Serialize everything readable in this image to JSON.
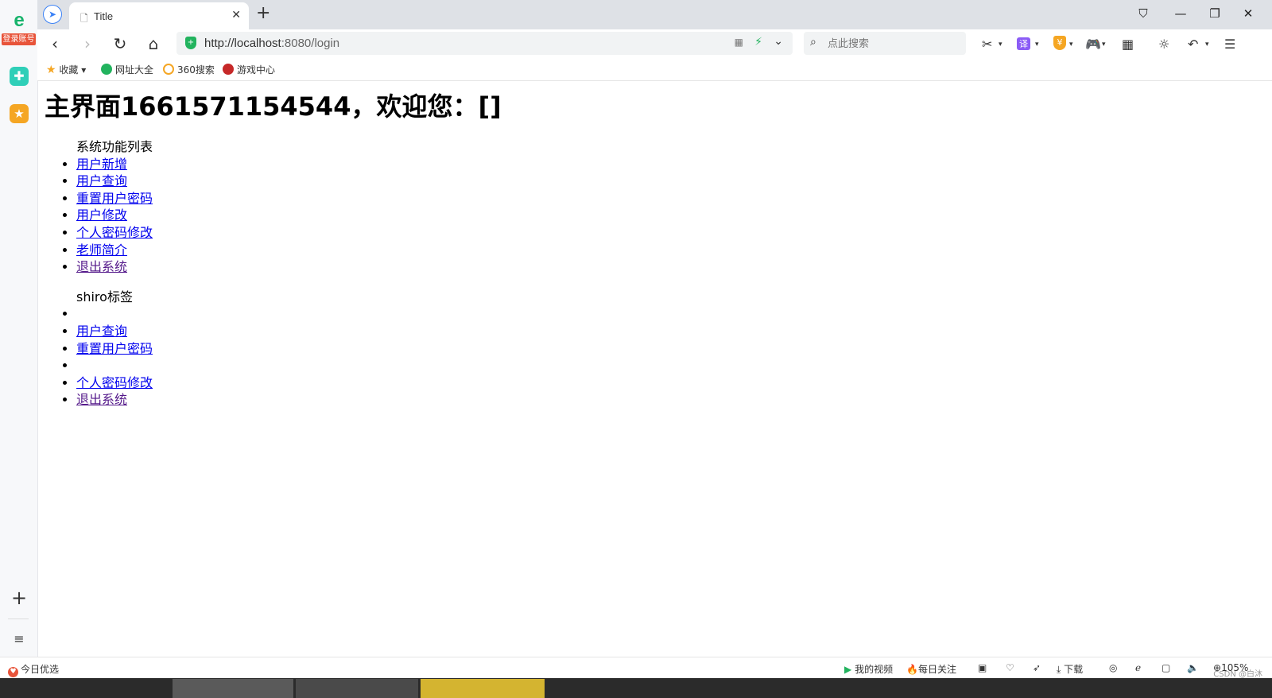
{
  "rail": {
    "logo_glyph": "e",
    "login_badge": "登录账号",
    "plus_glyph": "+",
    "list_glyph": "≡"
  },
  "tabs": [
    {
      "title": "Title",
      "close": "✕"
    }
  ],
  "new_tab": "+",
  "window_buttons": {
    "shirt": "👕",
    "minimize": "—",
    "restore": "❐",
    "close": "✕"
  },
  "toolbar": {
    "back": "‹",
    "forward": "›",
    "reload": "↻",
    "home": "⌂"
  },
  "address": {
    "url_main": "http://localhost",
    "url_rest": ":8080/login"
  },
  "search": {
    "placeholder": "点此搜索"
  },
  "tools": {
    "translate": "译",
    "wallet": "¥"
  },
  "bookmarks": {
    "favorites": "收藏",
    "items": [
      "网址大全",
      "360搜索",
      "游戏中心"
    ]
  },
  "page": {
    "heading": "主界面1661571154544，欢迎您：[]",
    "section1": {
      "caption": "系统功能列表",
      "links": [
        "用户新增",
        "用户查询",
        "重置用户密码",
        "用户修改",
        "个人密码修改",
        "老师简介",
        "退出系统"
      ]
    },
    "section2": {
      "caption": "shiro标签",
      "links": [
        "",
        "用户查询",
        "重置用户密码",
        "",
        "个人密码修改",
        "退出系统"
      ]
    }
  },
  "statusbar": {
    "left": "今日优选",
    "my_video": "我的视频",
    "daily_follow": "每日关注",
    "download": "下载",
    "zoom": "105%",
    "watermark": "CSDN @白沐"
  },
  "colors": {
    "link": "#0000ee",
    "visited_link": "#551a8b",
    "accent_green": "#22b35e"
  }
}
